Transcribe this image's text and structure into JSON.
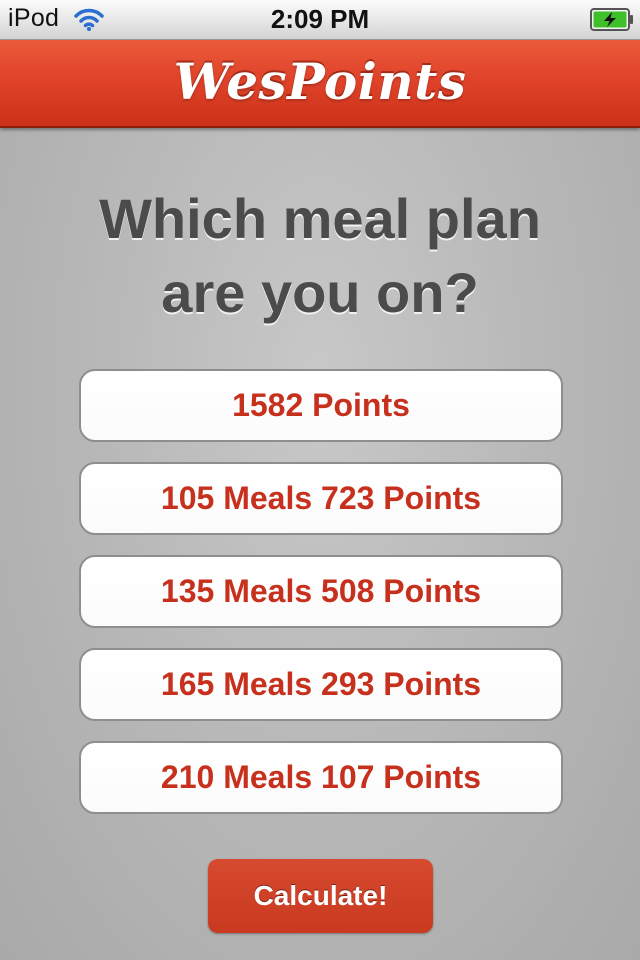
{
  "status_bar": {
    "carrier": "iPod",
    "time": "2:09 PM",
    "wifi_icon": "wifi-icon",
    "battery_icon": "battery-charging-icon"
  },
  "nav": {
    "title": "WesPoints"
  },
  "prompt": {
    "line1": "Which meal plan",
    "line2": "are you on?"
  },
  "plans": [
    "1582 Points",
    "105 Meals 723 Points",
    "135 Meals 508 Points",
    "165 Meals 293 Points",
    "210 Meals 107 Points"
  ],
  "calculate_label": "Calculate!",
  "colors": {
    "accent": "#d7432a",
    "button_text": "#c7301d",
    "question_text": "#4b4b4b"
  }
}
